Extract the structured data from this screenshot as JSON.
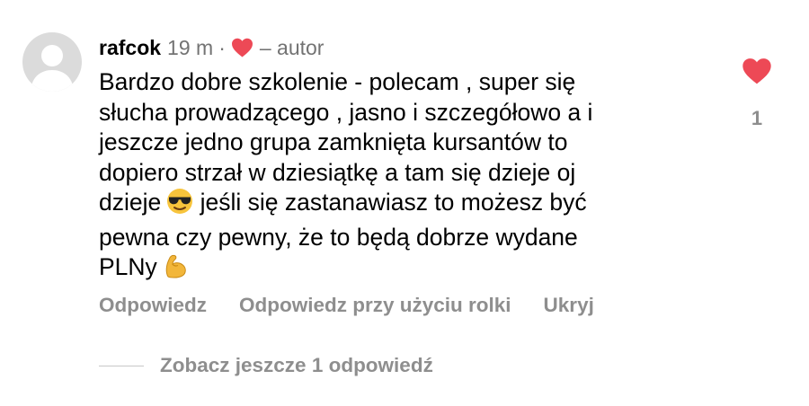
{
  "comment": {
    "username": "rafcok",
    "time": "19 m",
    "separator": "·",
    "author_label": "– autor",
    "text_before_emoji": "Bardzo dobre szkolenie - polecam , super się\nsłucha prowadzącego , jasno i szczegółowo a i\njeszcze jedno grupa zamknięta kursantów to\ndopiero strzał w dziesiątkę a tam się dzieje oj\ndzieje",
    "text_middle": " jeśli się zastanawiasz to możesz być\npewna czy pewny, że to będą dobrze wydane\nPLNy",
    "emoji_1": "sunglasses-emoji",
    "emoji_2": "flexed-biceps-emoji",
    "like_count": "1",
    "colors": {
      "heart": "#ed4956",
      "muted": "#8e8e8e",
      "avatar_bg": "#dbdbdb"
    }
  },
  "actions": {
    "reply": "Odpowiedz",
    "reply_with_reel": "Odpowiedz przy użyciu rolki",
    "hide": "Ukryj"
  },
  "replies": {
    "view_more": "Zobacz jeszcze 1 odpowiedź"
  }
}
